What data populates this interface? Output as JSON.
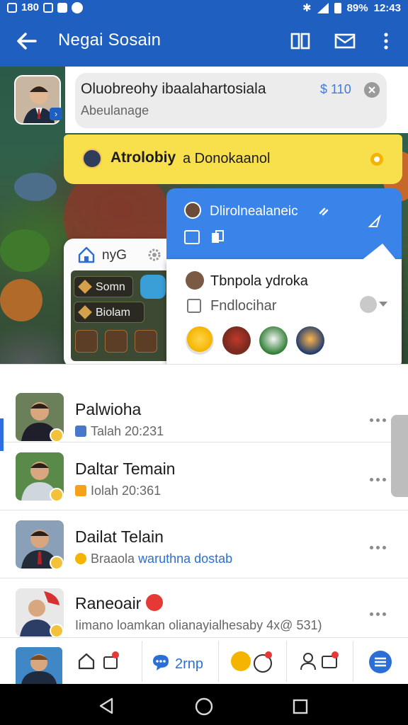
{
  "status_bar": {
    "left_text": "180",
    "battery_text": "89%",
    "time": "12:43",
    "icons": [
      "notification-icon",
      "box-icon",
      "app-icon",
      "alert-icon",
      "bluetooth-icon",
      "signal-icon",
      "battery-icon"
    ]
  },
  "top_bar": {
    "title": "Negai Sosain",
    "icons": [
      "back-arrow-icon",
      "book-icon",
      "mail-icon",
      "more-vertical-icon"
    ]
  },
  "message": {
    "title": "Oluobreohy ibaalahartosiala",
    "subtitle": "Abeulanage",
    "price": "$ 110"
  },
  "banner": {
    "bold": "Atrolobiy",
    "text": "a Donokaanol",
    "color": "#f8df4c"
  },
  "inventory": {
    "label": "nyG",
    "buttons": [
      "Somn",
      "Biolam"
    ]
  },
  "blue_card": {
    "title": "Dlirolnealaneic",
    "color": "#3a83e8"
  },
  "white_card": {
    "title": "Tbnpola ydroka",
    "subtitle": "Fndlocihar",
    "emojis": [
      "smile-emoji",
      "heart-emoji",
      "sad-emoji",
      "wink-emoji"
    ]
  },
  "chats": [
    {
      "name": "Palwioha",
      "sub": "Talah 20:231",
      "selected": true
    },
    {
      "name": "Daltar Temain",
      "sub": "Iolah 20:361",
      "selected": false
    },
    {
      "name": "Dailat Telain",
      "sub_prefix": "Braaola",
      "sub_link": "waruthna dostab",
      "selected": false
    },
    {
      "name": "Raneoair",
      "sub": "Iimano loamkan olianayialhesaby 4x@ 531)",
      "selected": false
    }
  ],
  "bottom_nav": {
    "label": "2rnp",
    "items": [
      "profile-avatar",
      "home-icon",
      "chat-icon",
      "messages-icon",
      "emoji-icon",
      "contacts-icon",
      "menu-icon"
    ]
  },
  "accent": "#1f5fbf"
}
